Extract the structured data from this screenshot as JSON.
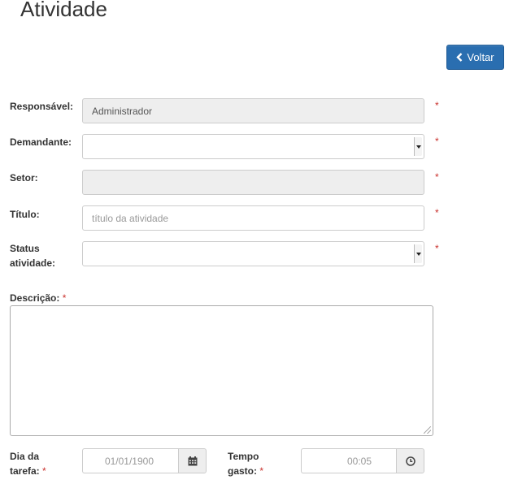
{
  "page": {
    "title": "Atividade"
  },
  "toolbar": {
    "back_label": "Voltar",
    "back_icon": "chevron-left-icon"
  },
  "form": {
    "required_marker": "*",
    "responsavel": {
      "label": "Responsável:",
      "value": "Administrador"
    },
    "demandante": {
      "label": "Demandante:",
      "value": ""
    },
    "setor": {
      "label": "Setor:",
      "value": ""
    },
    "titulo": {
      "label": "Título:",
      "placeholder": "título da atividade"
    },
    "status": {
      "label_line1": "Status",
      "label_line2": "atividade:",
      "value": ""
    },
    "descricao": {
      "label": "Descrição:"
    },
    "dia": {
      "label_line1": "Dia da",
      "label_line2": "tarefa:",
      "value": "01/01/1900",
      "icon": "calendar-icon"
    },
    "tempo": {
      "label_line1": "Tempo",
      "label_line2": "gasto:",
      "value": "00:05",
      "icon": "clock-icon"
    }
  },
  "colors": {
    "accent": "#2a6eb0",
    "required": "#c9302c",
    "disabled_bg": "#eeeeee"
  }
}
